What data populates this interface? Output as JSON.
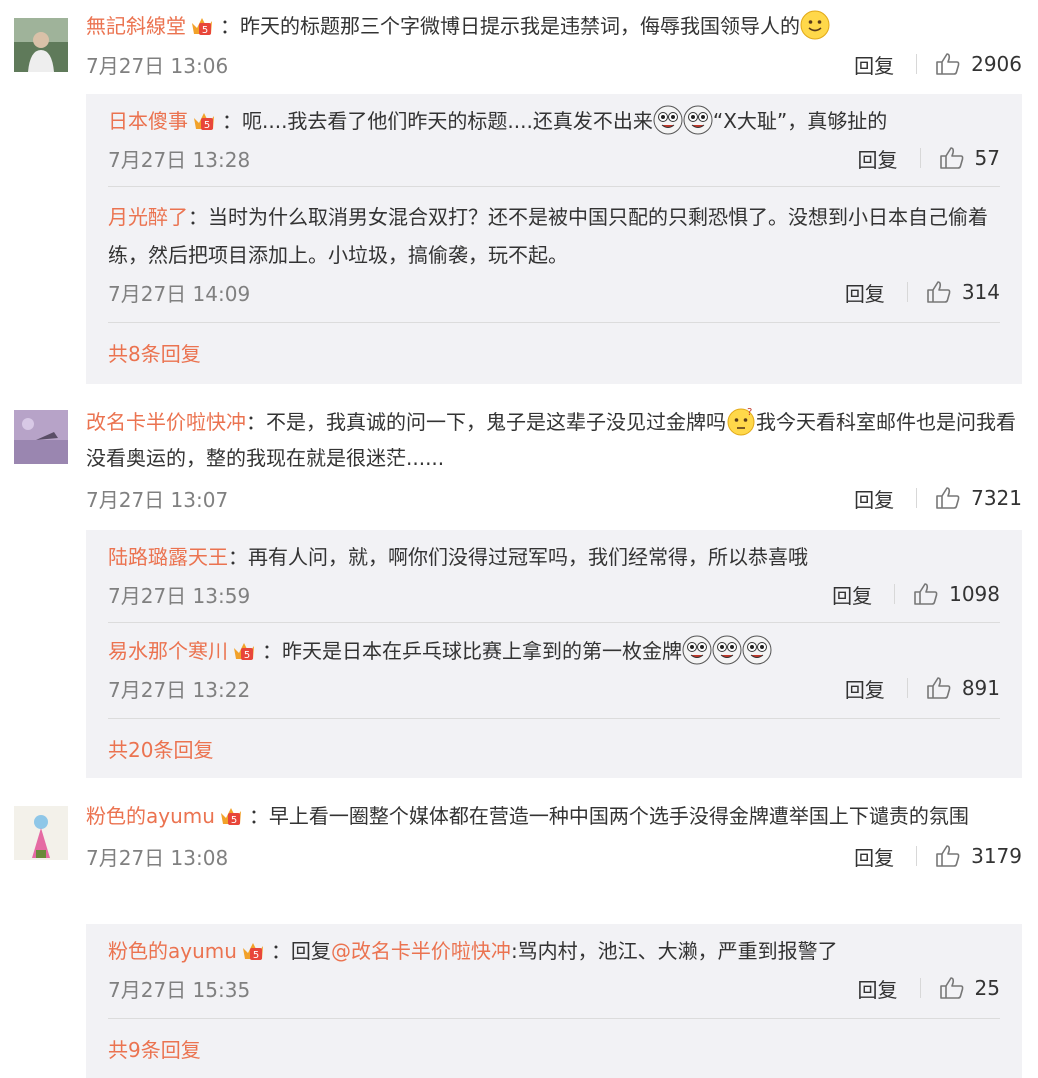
{
  "comments": [
    {
      "user": "無記斜線堂",
      "text": "：昨天的标题那三个字微博日提示我是违禁词，侮辱我国领导人的",
      "time": "7月27日 13:06",
      "reply_label": "回复",
      "likes": "2906",
      "replies": [
        {
          "user": "日本傻事",
          "text": "：呃....我去看了他们昨天的标题....还真发不出来",
          "text2": "“X大耻”，真够扯的",
          "time": "7月27日 13:28",
          "reply_label": "回复",
          "likes": "57"
        },
        {
          "user": "月光醉了",
          "text": "：当时为什么取消男女混合双打？还不是被中国只配的只剩恐惧了。没想到小日本自己偷着练，然后把项目添加上。小垃圾，搞偷袭，玩不起。",
          "time": "7月27日 14:09",
          "reply_label": "回复",
          "likes": "314"
        }
      ],
      "more": "共8条回复"
    },
    {
      "user": "改名卡半价啦快冲",
      "text": "：不是，我真诚的问一下，鬼子是这辈子没见过金牌吗",
      "text2": "我今天看科室邮件也是问我看没看奥运的，整的我现在就是很迷茫......",
      "time": "7月27日 13:07",
      "reply_label": "回复",
      "likes": "7321",
      "replies": [
        {
          "user": "陆路璐露天王",
          "text": "：再有人问，就，啊你们没得过冠军吗，我们经常得，所以恭喜哦",
          "time": "7月27日 13:59",
          "reply_label": "回复",
          "likes": "1098"
        },
        {
          "user": "易水那个寒川",
          "text": "：昨天是日本在乒乓球比赛上拿到的第一枚金牌",
          "time": "7月27日 13:22",
          "reply_label": "回复",
          "likes": "891"
        }
      ],
      "more": "共20条回复"
    },
    {
      "user": "粉色的ayumu",
      "text": "：早上看一圈整个媒体都在营造一种中国两个选手没得金牌遭举国上下谴责的氛围",
      "time": "7月27日 13:08",
      "reply_label": "回复",
      "likes": "3179",
      "replies": [
        {
          "user": "粉色的ayumu",
          "text": "：回复",
          "mention": "@改名卡半价啦快冲",
          "text2": ":骂内村，池江、大濑，严重到报警了",
          "time": "7月27日 15:35",
          "reply_label": "回复",
          "likes": "25"
        }
      ],
      "more": "共9条回复"
    }
  ],
  "colors": {
    "username": "#eb7350",
    "reply_bg": "#f2f2f5",
    "time": "#808080"
  }
}
